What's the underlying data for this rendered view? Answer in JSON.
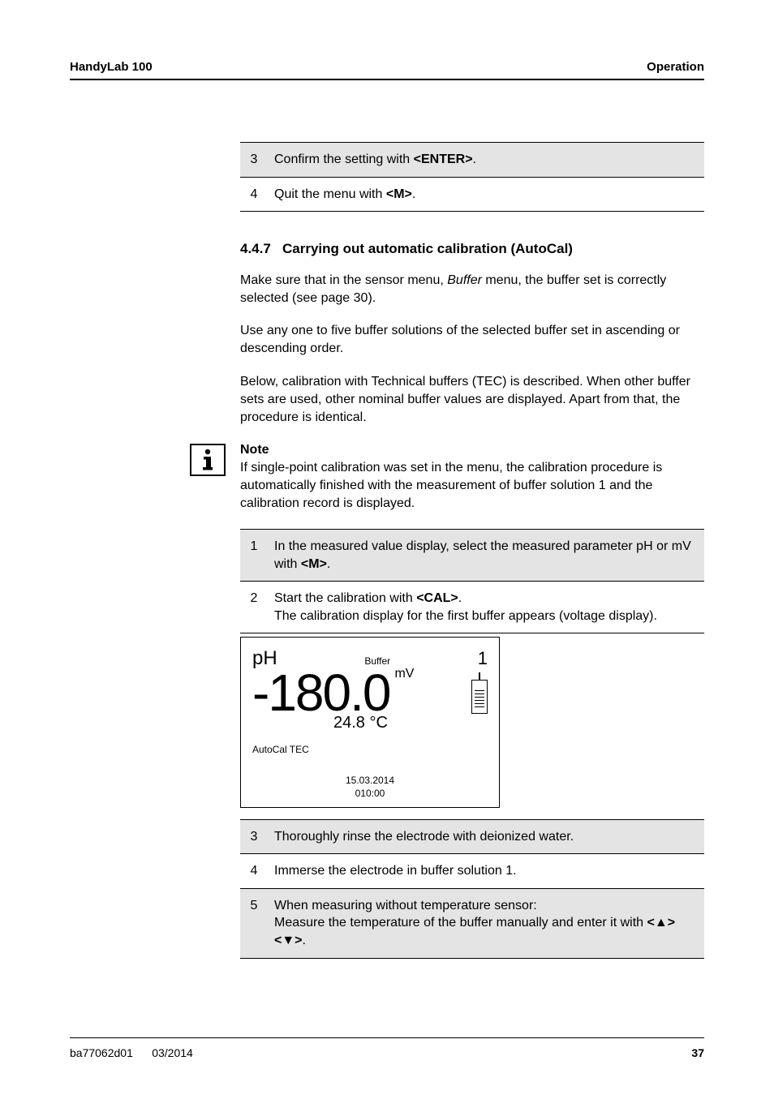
{
  "header": {
    "left": "HandyLab 100",
    "right": "Operation"
  },
  "steps_a": [
    {
      "n": "3",
      "text_pre": "Confirm the setting with ",
      "key": "<ENTER>",
      "text_post": "."
    },
    {
      "n": "4",
      "text_pre": "Quit the menu with ",
      "key": "<M>",
      "text_post": "."
    }
  ],
  "section": {
    "num": "4.4.7",
    "title": "Carrying out automatic calibration (AutoCal)"
  },
  "para1_a": "Make sure that in the sensor menu, ",
  "para1_i": "Buffer",
  "para1_b": " menu, the buffer set is correctly selected (see page 30).",
  "para2": "Use any one to five buffer solutions of the selected buffer set in ascending or descending order.",
  "para3": "Below, calibration with Technical buffers (TEC) is described. When other buffer sets are used, other nominal buffer values are displayed. Apart from that, the procedure is identical.",
  "note": {
    "head": "Note",
    "body": "If single-point calibration was set in the menu, the calibration procedure is automatically finished with the measurement of buffer solution 1 and the calibration record is displayed."
  },
  "steps_b": {
    "r1": {
      "n": "1",
      "pre": "In the measured value display, select the measured parameter pH or mV with ",
      "key": "<M>",
      "post": "."
    },
    "r2": {
      "n": "2",
      "pre": "Start the calibration with ",
      "key": "<CAL>",
      "post": ".",
      "line2": "The calibration display for the first buffer appears (voltage display)."
    }
  },
  "lcd": {
    "ph": "pH",
    "buffer": "Buffer",
    "bnum": "1",
    "reading": "-180.0",
    "unit": "mV",
    "temp": "24.8 °C",
    "mode": "AutoCal TEC",
    "date": "15.03.2014",
    "time": "010:00"
  },
  "steps_c": {
    "r3": {
      "n": "3",
      "text": "Thoroughly rinse the electrode with deionized water."
    },
    "r4": {
      "n": "4",
      "text": "Immerse the electrode in buffer solution 1."
    },
    "r5": {
      "n": "5",
      "l1": "When measuring without temperature sensor:",
      "l2_pre": "Measure the temperature of the buffer manually and enter it with ",
      "key": "<▲><▼>",
      "l2_post": "."
    }
  },
  "footer": {
    "left1": "ba77062d01",
    "left2": "03/2014",
    "page": "37"
  }
}
